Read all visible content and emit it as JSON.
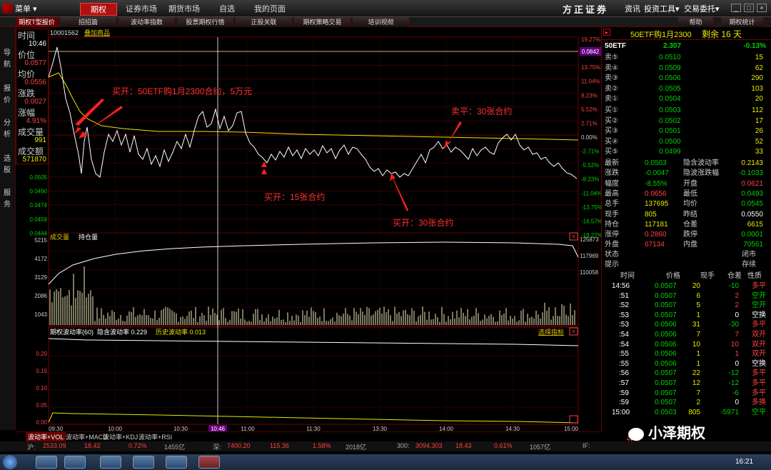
{
  "titlebar": {
    "menu": "菜单",
    "nav": [
      "期权",
      "证券市场",
      "期货市场",
      "自选",
      "我的页面"
    ],
    "brand": "方正证券",
    "right_menu": [
      "资讯",
      "投资工具",
      "交易委托"
    ]
  },
  "subtabs": [
    "期权T型报价",
    "招招篇",
    "波动率指数",
    "股票期权行情",
    "正股关联",
    "期权策略交易",
    "培训视频"
  ],
  "subtabs_right": [
    "帮助",
    "期权统计"
  ],
  "sidebar": [
    "导",
    "航",
    "报",
    "价",
    "分",
    "析",
    "选",
    "股",
    "服",
    "务"
  ],
  "chart_header": {
    "code": "10001562",
    "add": "叠加商品"
  },
  "info": {
    "time_label": "时间",
    "time": "10:46",
    "price_label": "价位",
    "price": "0.0577",
    "avg_label": "均价",
    "avg": "0.0556",
    "chg_label": "涨跌",
    "chg": "0.0027",
    "pct_label": "涨幅",
    "pct": "4.91%",
    "vol_label": "成交量",
    "vol": "991",
    "amt_label": "成交额",
    "amt": "571870"
  },
  "price_axis": {
    "left": [
      "0.0505",
      "0.0490",
      "0.0474",
      "0.0459",
      "0.0444"
    ],
    "right": [
      "19.27%",
      "16.54%",
      "13.75%",
      "11.04%",
      "8.23%",
      "5.52%",
      "2.71%",
      "0.00%",
      "-2.71%",
      "-5.52%",
      "-8.23%",
      "-11.04%",
      "-13.75%",
      "-16.57%",
      "-19.27%"
    ],
    "cursor": "0.0842"
  },
  "annotations": [
    "买开：50ETF购1月2300合约，5万元",
    "卖平：30张合约",
    "买开：15张合约",
    "买开：30张合约"
  ],
  "volume_panel": {
    "label1": "成交量",
    "label2": "持仓量",
    "left": [
      "5215",
      "4172",
      "3129",
      "2086",
      "1043"
    ],
    "right": [
      "125873",
      "117969",
      "110058"
    ]
  },
  "iv_panel": {
    "title": "期权波动率(60)",
    "implied": "隐含波动率 0.229",
    "hist": "历史波动率 0.013",
    "select": "选择指标",
    "axis": [
      "0.20",
      "0.15",
      "0.10",
      "0.05",
      "0.00"
    ]
  },
  "time_axis": [
    "09:30",
    "10:00",
    "10:30",
    "10:46",
    "11:00",
    "11:30",
    "13:30",
    "14:00",
    "14:30",
    "15:00"
  ],
  "bottom_tabs": [
    "波动率+VOL",
    "波动率+MACD",
    "波动率+KDJ",
    "波动率+RSI"
  ],
  "rp": {
    "title": "50ETF购1月2300",
    "remain": "剩余 16 天",
    "etf": {
      "name": "50ETF",
      "price": "2.307",
      "pct": "-0.13%"
    },
    "sell": [
      {
        "l": "卖⑤",
        "p": "0.0510",
        "v": "15"
      },
      {
        "l": "卖④",
        "p": "0.0509",
        "v": "62"
      },
      {
        "l": "卖③",
        "p": "0.0506",
        "v": "290"
      },
      {
        "l": "卖②",
        "p": "0.0505",
        "v": "103"
      },
      {
        "l": "卖①",
        "p": "0.0504",
        "v": "20"
      }
    ],
    "buy": [
      {
        "l": "买①",
        "p": "0.0503",
        "v": "112"
      },
      {
        "l": "买②",
        "p": "0.0502",
        "v": "17"
      },
      {
        "l": "买③",
        "p": "0.0501",
        "v": "26"
      },
      {
        "l": "买④",
        "p": "0.0500",
        "v": "52"
      },
      {
        "l": "买⑤",
        "p": "0.0499",
        "v": "33"
      }
    ],
    "stats": [
      [
        "最新",
        "0.0503",
        "隐含波动率",
        "0.2143"
      ],
      [
        "涨跌",
        "-0.0047",
        "隐波涨跌幅",
        "-0.1033"
      ],
      [
        "幅度",
        "-8.55%",
        "开盘",
        "0.0621"
      ],
      [
        "最高",
        "0.0656",
        "最低",
        "0.0493"
      ],
      [
        "总手",
        "137695",
        "均价",
        "0.0545"
      ],
      [
        "现手",
        "805",
        "昨结",
        "0.0550"
      ],
      [
        "持仓",
        "117181",
        "仓差",
        "6615"
      ],
      [
        "涨停",
        "0.2860",
        "跌停",
        "0.0001"
      ],
      [
        "外盘",
        "67134",
        "内盘",
        "70561"
      ]
    ],
    "status": [
      [
        "状态",
        "闭市"
      ],
      [
        "提示",
        "存续"
      ]
    ],
    "tick_header": [
      "时间",
      "价格",
      "现手",
      "仓差",
      "性质"
    ],
    "ticks": [
      [
        "14:56",
        "0.0507",
        "20",
        "-10",
        "多平"
      ],
      [
        ":51",
        "0.0507",
        "6",
        "2",
        "空开"
      ],
      [
        ":52",
        "0.0507",
        "5",
        "2",
        "空开"
      ],
      [
        ":53",
        "0.0507",
        "1",
        "0",
        "空换"
      ],
      [
        ":53",
        "0.0506",
        "31",
        "-30",
        "多平"
      ],
      [
        ":54",
        "0.0506",
        "7",
        "7",
        "双开"
      ],
      [
        ":54",
        "0.0506",
        "10",
        "10",
        "双开"
      ],
      [
        ":55",
        "0.0506",
        "1",
        "1",
        "双开"
      ],
      [
        ":55",
        "0.0506",
        "1",
        "0",
        "空换"
      ],
      [
        ":56",
        "0.0507",
        "22",
        "-12",
        "多平"
      ],
      [
        ":57",
        "0.0507",
        "12",
        "-12",
        "多平"
      ],
      [
        ":59",
        "0.0507",
        "7",
        "-6",
        "多平"
      ],
      [
        ":59",
        "0.0507",
        "2",
        "0",
        "多换"
      ],
      [
        "15:00",
        "0.0503",
        "805",
        "-5971",
        "空平"
      ]
    ],
    "footer": "分笔"
  },
  "statusbar": [
    "沪:",
    "2533.09",
    "18.42",
    "0.72%",
    "1455亿",
    "深:",
    "7400.20",
    "115.36",
    "1.58%",
    "2018亿",
    "300:",
    "3094.303",
    "18.43",
    "0.61%",
    "1057亿",
    "IF:"
  ],
  "watermark": "小泽期权",
  "clock": "16:21",
  "colors": {
    "up": "#ff4040",
    "down": "#00d000",
    "yellow": "#ffff40",
    "white": "#ffffff",
    "grid": "#7a0000"
  }
}
